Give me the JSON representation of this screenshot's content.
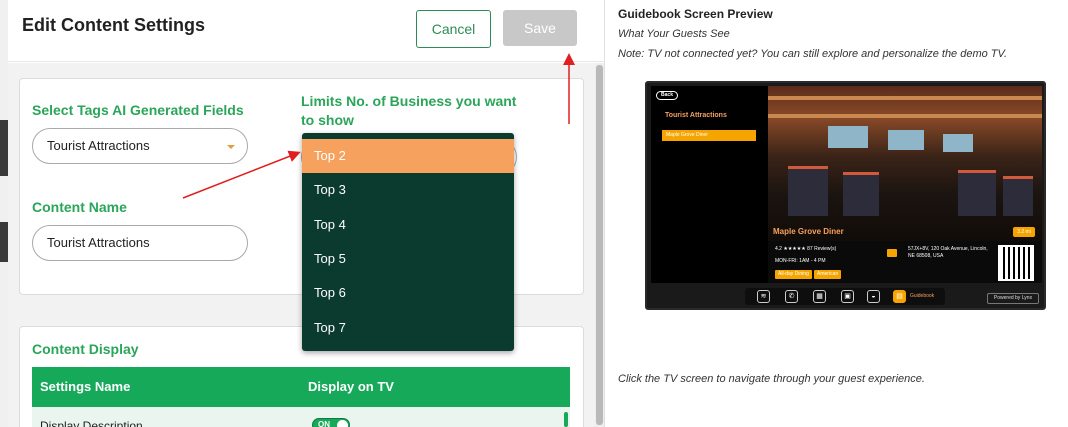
{
  "editor": {
    "title": "Edit Content Settings",
    "cancel_label": "Cancel",
    "save_label": "Save"
  },
  "tags_field": {
    "label": "Select Tags AI Generated Fields",
    "value": "Tourist Attractions"
  },
  "limits_field": {
    "label_line1": "Limits No. of Business you want",
    "label_line2": "to show",
    "options": [
      "Top 2",
      "Top 3",
      "Top 4",
      "Top 5",
      "Top 6",
      "Top 7"
    ],
    "selected": "Top 2"
  },
  "content_name": {
    "label": "Content Name",
    "value": "Tourist Attractions"
  },
  "content_display": {
    "title": "Content Display",
    "columns": [
      "Settings Name",
      "Display on TV"
    ],
    "rows": [
      {
        "name": "Display Description",
        "toggle": "ON"
      }
    ]
  },
  "preview": {
    "title": "Guidebook Screen Preview",
    "subtitle": "What Your Guests See",
    "note": "Note: TV not connected yet? You can still explore and personalize the demo TV.",
    "footer": "Click the TV screen to navigate through your guest experience.",
    "tv": {
      "back": "Back",
      "category": "Tourist Attractions",
      "item": "Maple Grove Diner",
      "name": "Maple Grove Diner",
      "distance": "3.2 mi",
      "rating_text": "4.2 ★★★★★ 87 Review(s)",
      "hours": "MON-FRI: 1AM - 4 PM",
      "chips": [
        "All-day Dining",
        "American"
      ],
      "address": "57JX+8V, 120 Oak Avenue, Lincoln, NE 68508, USA",
      "bar_label": "Guidebook",
      "powered": "Powered by Lynx"
    }
  },
  "colors": {
    "green": "#16a95a",
    "green_text": "#2aa55a",
    "dropdown_bg": "#0b3b2f",
    "dropdown_active": "#f6a15e",
    "arrow_red": "#e02020"
  }
}
